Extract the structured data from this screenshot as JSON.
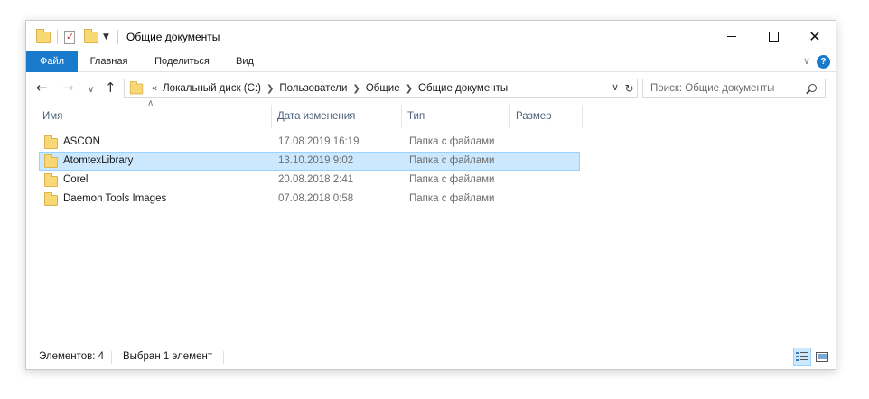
{
  "window": {
    "title": "Общие документы"
  },
  "ribbon": {
    "tabs": [
      {
        "label": "Файл",
        "active": true
      },
      {
        "label": "Главная"
      },
      {
        "label": "Поделиться"
      },
      {
        "label": "Вид"
      }
    ],
    "help_label": "?"
  },
  "nav": {
    "back_icon": "arrow-left-icon",
    "forward_icon": "arrow-right-icon",
    "recent_icon": "chevron-down-icon",
    "up_icon": "arrow-up-icon",
    "breadcrumb_overflow": "«",
    "breadcrumbs": [
      "Локальный диск (C:)",
      "Пользователи",
      "Общие",
      "Общие документы"
    ]
  },
  "search": {
    "placeholder": "Поиск: Общие документы"
  },
  "columns": [
    "Имя",
    "Дата изменения",
    "Тип",
    "Размер"
  ],
  "files": [
    {
      "name": "ASCON",
      "date": "17.08.2019 16:19",
      "type": "Папка с файлами",
      "selected": false
    },
    {
      "name": "AtomtexLibrary",
      "date": "13.10.2019 9:02",
      "type": "Папка с файлами",
      "selected": true
    },
    {
      "name": "Corel",
      "date": "20.08.2018 2:41",
      "type": "Папка с файлами",
      "selected": false
    },
    {
      "name": "Daemon Tools Images",
      "date": "07.08.2018 0:58",
      "type": "Папка с файлами",
      "selected": false
    }
  ],
  "status": {
    "items_count": "Элементов: 4",
    "selected_count": "Выбран 1 элемент"
  },
  "colors": {
    "accent": "#1979ca",
    "selection_bg": "#cce8ff",
    "selection_border": "#99d1ff",
    "folder": "#f8d775"
  }
}
